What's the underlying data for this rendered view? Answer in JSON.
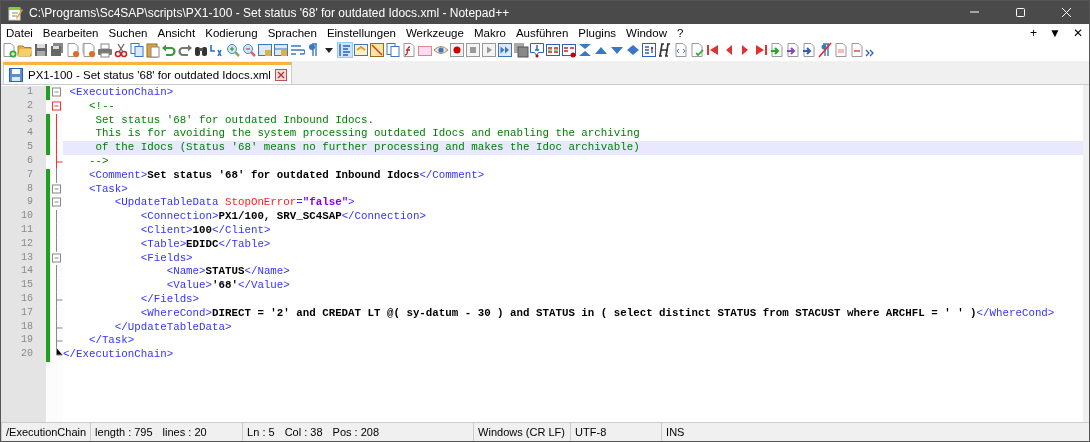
{
  "window": {
    "title": "C:\\Programs\\Sc4SAP\\scripts\\PX1-100 - Set status '68' for outdated Idocs.xml - Notepad++"
  },
  "menu": [
    "Datei",
    "Bearbeiten",
    "Suchen",
    "Ansicht",
    "Kodierung",
    "Sprachen",
    "Einstellungen",
    "Werkzeuge",
    "Makro",
    "Ausführen",
    "Plugins",
    "Window",
    "?"
  ],
  "menu_controls": [
    "+",
    "▼",
    "✕"
  ],
  "tabs": [
    {
      "label": "PX1-100 - Set status '68' for outdated Idocs.xml",
      "selected": true
    }
  ],
  "editor": {
    "lines": [
      {
        "number": "1",
        "kind": "open",
        "changed": true,
        "current": false,
        "tokens": [
          {
            "kind": "tag",
            "text": " <ExecutionChain>"
          }
        ]
      },
      {
        "number": "2",
        "kind": "open-red",
        "changed": false,
        "current": false,
        "tokens": [
          {
            "kind": "comment",
            "text": "    <!--"
          }
        ]
      },
      {
        "number": "3",
        "kind": "line-red",
        "changed": true,
        "current": false,
        "tokens": [
          {
            "kind": "comment",
            "text": "     Set status '68' for outdated Inbound Idocs."
          }
        ]
      },
      {
        "number": "4",
        "kind": "line-red",
        "changed": true,
        "current": false,
        "tokens": [
          {
            "kind": "comment",
            "text": "     This is for avoiding the system processing outdated Idocs and enabling the archiving"
          }
        ]
      },
      {
        "number": "5",
        "kind": "line-red",
        "changed": true,
        "current": true,
        "tokens": [
          {
            "kind": "comment",
            "text": "     of the Idocs (Status '68' means no further processing and makes the Idoc archivable)"
          }
        ]
      },
      {
        "number": "6",
        "kind": "end-red",
        "changed": false,
        "current": false,
        "tokens": [
          {
            "kind": "comment",
            "text": "    -->"
          }
        ]
      },
      {
        "number": "7",
        "kind": "line",
        "changed": true,
        "current": false,
        "tokens": [
          {
            "kind": "tag",
            "text": "    <Comment>"
          },
          {
            "kind": "text",
            "text": "Set status '68' for outdated Inbound Idocs"
          },
          {
            "kind": "tag",
            "text": "</Comment>"
          }
        ]
      },
      {
        "number": "8",
        "kind": "open",
        "changed": true,
        "current": false,
        "tokens": [
          {
            "kind": "tag",
            "text": "    <Task>"
          }
        ]
      },
      {
        "number": "9",
        "kind": "open",
        "changed": true,
        "current": false,
        "tokens": [
          {
            "kind": "tag",
            "text": "        <UpdateTableData "
          },
          {
            "kind": "attr",
            "text": "StopOnError"
          },
          {
            "kind": "tag",
            "text": "="
          },
          {
            "kind": "value",
            "text": "\"false\""
          },
          {
            "kind": "tag",
            "text": ">"
          }
        ]
      },
      {
        "number": "10",
        "kind": "line",
        "changed": true,
        "current": false,
        "tokens": [
          {
            "kind": "tag",
            "text": "            <Connection>"
          },
          {
            "kind": "text",
            "text": "PX1/100, SRV_SC4SAP"
          },
          {
            "kind": "tag",
            "text": "</Connection>"
          }
        ]
      },
      {
        "number": "11",
        "kind": "line",
        "changed": true,
        "current": false,
        "tokens": [
          {
            "kind": "tag",
            "text": "            <Client>"
          },
          {
            "kind": "text",
            "text": "100"
          },
          {
            "kind": "tag",
            "text": "</Client>"
          }
        ]
      },
      {
        "number": "12",
        "kind": "line",
        "changed": true,
        "current": false,
        "tokens": [
          {
            "kind": "tag",
            "text": "            <Table>"
          },
          {
            "kind": "text",
            "text": "EDIDC"
          },
          {
            "kind": "tag",
            "text": "</Table>"
          }
        ]
      },
      {
        "number": "13",
        "kind": "open",
        "changed": true,
        "current": false,
        "tokens": [
          {
            "kind": "tag",
            "text": "            <Fields>"
          }
        ]
      },
      {
        "number": "14",
        "kind": "line",
        "changed": true,
        "current": false,
        "tokens": [
          {
            "kind": "tag",
            "text": "                <Name>"
          },
          {
            "kind": "text",
            "text": "STATUS"
          },
          {
            "kind": "tag",
            "text": "</Name>"
          }
        ]
      },
      {
        "number": "15",
        "kind": "line",
        "changed": true,
        "current": false,
        "tokens": [
          {
            "kind": "tag",
            "text": "                <Value>"
          },
          {
            "kind": "text",
            "text": "'68'"
          },
          {
            "kind": "tag",
            "text": "</Value>"
          }
        ]
      },
      {
        "number": "16",
        "kind": "end",
        "changed": true,
        "current": false,
        "tokens": [
          {
            "kind": "tag",
            "text": "            </Fields>"
          }
        ]
      },
      {
        "number": "17",
        "kind": "line",
        "changed": true,
        "current": false,
        "tokens": [
          {
            "kind": "tag",
            "text": "            <WhereCond>"
          },
          {
            "kind": "text",
            "text": "DIRECT = '2' and CREDAT LT @( sy-datum - 30 ) and STATUS in ( select distinct STATUS from STACUST where ARCHFL = ' ' )"
          },
          {
            "kind": "tag",
            "text": "</WhereCond>"
          }
        ]
      },
      {
        "number": "18",
        "kind": "end",
        "changed": true,
        "current": false,
        "tokens": [
          {
            "kind": "tag",
            "text": "        </UpdateTableData>"
          }
        ]
      },
      {
        "number": "19",
        "kind": "end",
        "changed": true,
        "current": false,
        "tokens": [
          {
            "kind": "tag",
            "text": "    </Task>"
          }
        ]
      },
      {
        "number": "20",
        "kind": "last",
        "changed": true,
        "current": false,
        "tokens": [
          {
            "kind": "tag",
            "text": "</ExecutionChain>"
          }
        ]
      }
    ]
  },
  "status_bar": [
    [
      "/ExecutionChain"
    ],
    [
      "length : 795",
      "lines : 20"
    ],
    [
      "Ln : 5",
      "Col : 38",
      "Pos : 208"
    ],
    [
      "Windows (CR LF)"
    ],
    [
      "UTF-8"
    ],
    [
      "INS"
    ]
  ]
}
